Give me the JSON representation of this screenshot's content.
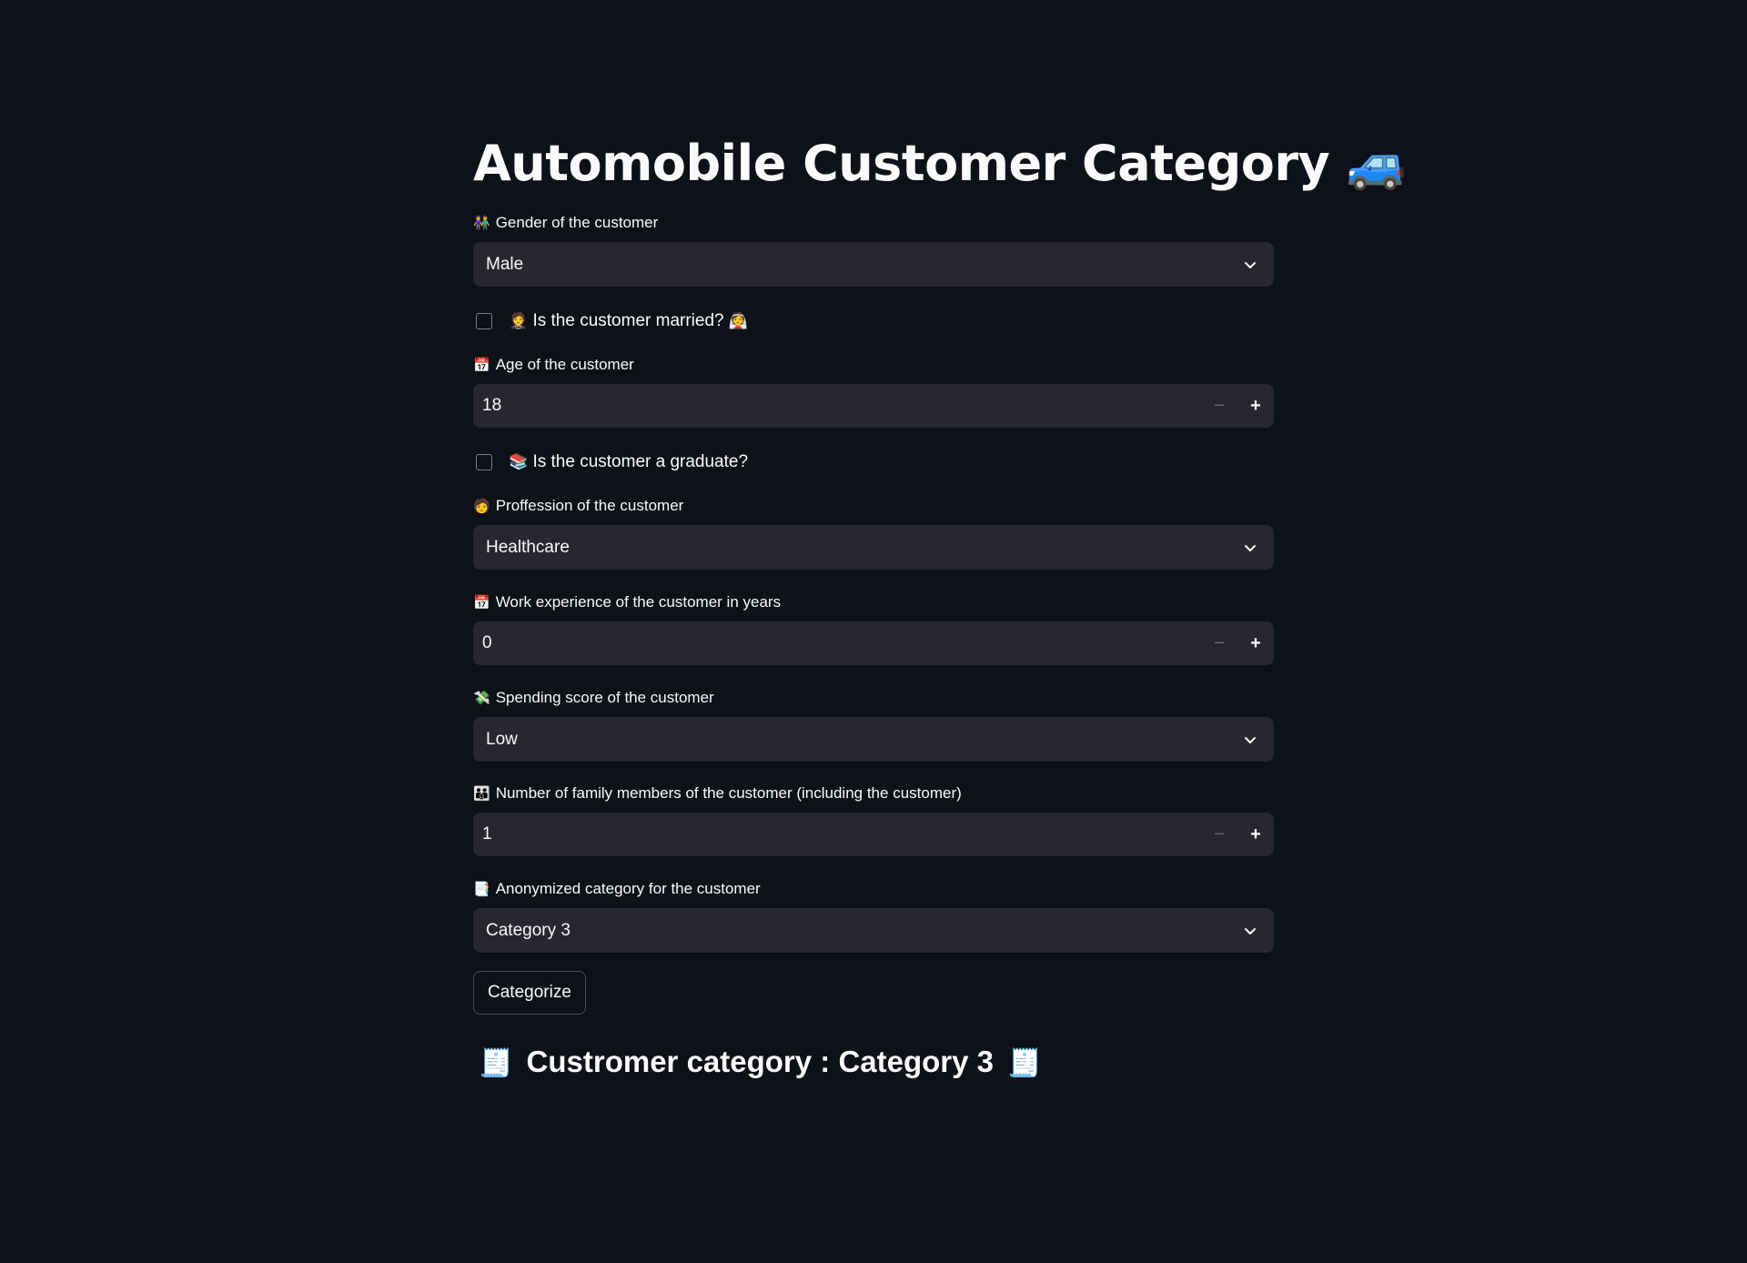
{
  "title": {
    "text": "Automobile Customer Category",
    "emoji": "🚙"
  },
  "gender": {
    "emoji": "👫",
    "label": "Gender of the customer",
    "value": "Male"
  },
  "married": {
    "emoji_before": "🤵",
    "label": "Is the customer married?",
    "emoji_after": "👰",
    "checked": false
  },
  "age": {
    "emoji": "📅",
    "label": "Age of the customer",
    "value": "18",
    "minus": "−",
    "plus": "+"
  },
  "graduate": {
    "emoji": "📚",
    "label": "Is the customer a graduate?",
    "checked": false
  },
  "profession": {
    "emoji": "🧑",
    "label": "Proffession of the customer",
    "value": "Healthcare"
  },
  "work_experience": {
    "emoji": "📅",
    "label": "Work experience of the customer in years",
    "value": "0",
    "minus": "−",
    "plus": "+"
  },
  "spending": {
    "emoji": "💸",
    "label": "Spending score of the customer",
    "value": "Low"
  },
  "family": {
    "emoji": "👪",
    "label": "Number of family members of the customer (including the customer)",
    "value": "1",
    "minus": "−",
    "plus": "+"
  },
  "category": {
    "emoji": "📑",
    "label": "Anonymized category for the customer",
    "value": "Category 3"
  },
  "button": {
    "label": "Categorize"
  },
  "result": {
    "emoji": "🧾",
    "text": "Custromer category : Category 3"
  },
  "colors": {
    "background": "#0e1118",
    "input_bg": "#262730",
    "text": "#fafafa"
  }
}
